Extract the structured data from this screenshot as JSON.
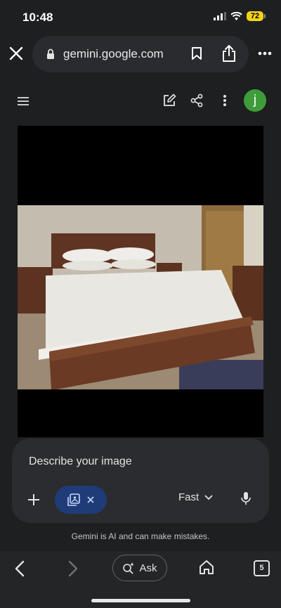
{
  "status": {
    "time": "10:48",
    "battery": "72"
  },
  "browser": {
    "url": "gemini.google.com"
  },
  "header": {
    "avatar_letter": "j"
  },
  "prompt": {
    "placeholder": "Describe your image",
    "mode": "Fast"
  },
  "disclaimer": "Gemini is AI and can make mistakes.",
  "toolbar": {
    "ask_label": "Ask",
    "tab_count": "5"
  },
  "colors": {
    "accent_chip": "#1f3c78",
    "avatar": "#3e9d3a",
    "battery": "#f2d31b"
  }
}
